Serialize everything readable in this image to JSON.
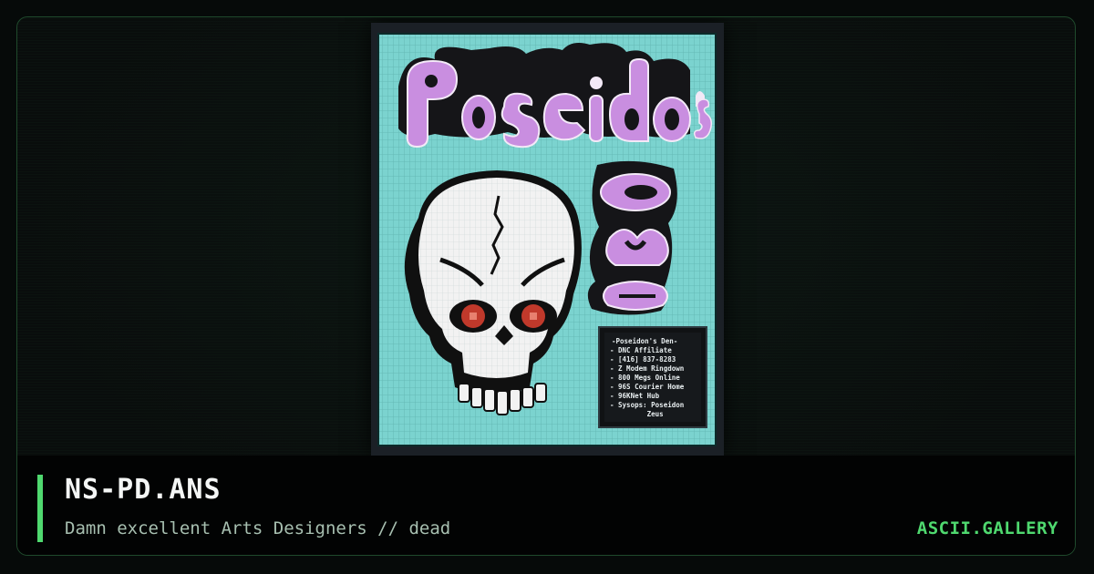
{
  "artwork": {
    "logo_text": "Poseidon's",
    "info_box_lines": [
      "-Poseidon's Den-",
      "- DNC Affiliate",
      "- [416] 837-8283",
      "- Z Modem Ringdown",
      "- 800 Megs Online",
      "- 96S Courier Home",
      "- 96KNet Hub",
      "- Sysops: Poseidon",
      "         Zeus"
    ],
    "colors": {
      "background": "#7bd3cf",
      "logo_fill": "#c98ee0",
      "skull": "#f2f2f2",
      "eyes": "#c0392b",
      "outline": "#101010"
    }
  },
  "caption": {
    "title": "NS-PD.ANS",
    "subtitle": "Damn excellent Arts Designers // dead",
    "brand": "ASCII.GALLERY"
  },
  "colors": {
    "accent": "#4fd96f",
    "page_background": "#060a09"
  }
}
